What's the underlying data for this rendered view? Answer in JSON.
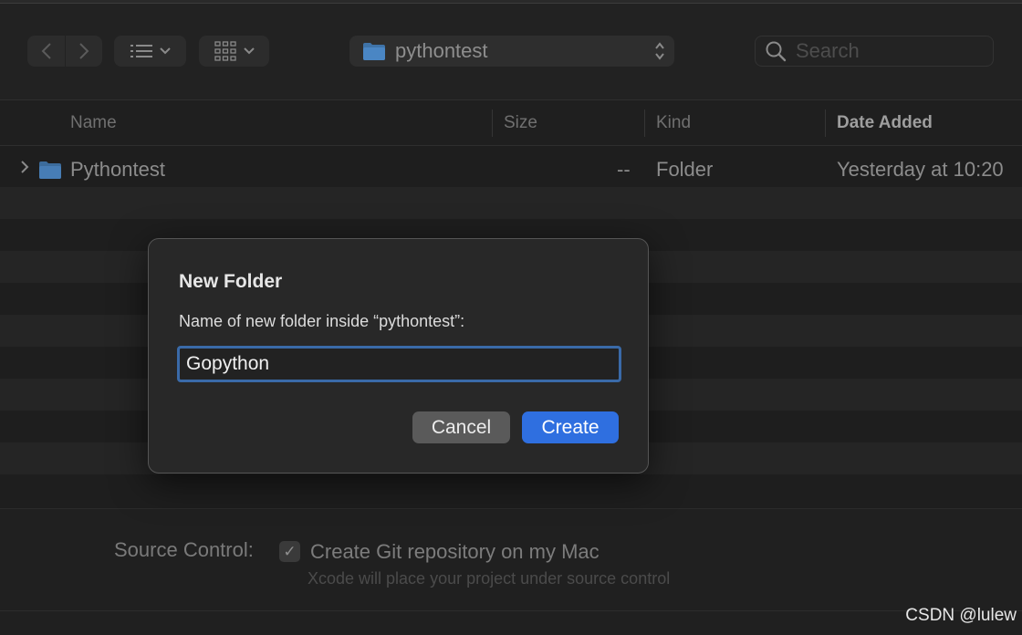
{
  "toolbar": {
    "back_icon": "chevron-left-icon",
    "forward_icon": "chevron-right-icon",
    "list_view_icon": "list-icon",
    "grid_view_icon": "grid-icon",
    "path": "pythontest",
    "search_placeholder": "Search"
  },
  "columns": {
    "name": "Name",
    "size": "Size",
    "kind": "Kind",
    "date_added": "Date Added"
  },
  "file_row": {
    "name": "Pythontest",
    "size": "--",
    "kind": "Folder",
    "date_added": "Yesterday at 10:20"
  },
  "dialog": {
    "title": "New Folder",
    "message": "Name of new folder inside “pythontest”:",
    "input_value": "Gopython",
    "cancel_label": "Cancel",
    "create_label": "Create"
  },
  "source_control": {
    "label": "Source Control:",
    "checkbox_label": "Create Git repository on my Mac",
    "checked": true,
    "subtext": "Xcode will place your project under source control"
  },
  "watermark": "CSDN @lulew",
  "colors": {
    "accent": "#2f6fe0",
    "focus_ring": "#3a6aa8",
    "folder": "#4a7fb5"
  }
}
